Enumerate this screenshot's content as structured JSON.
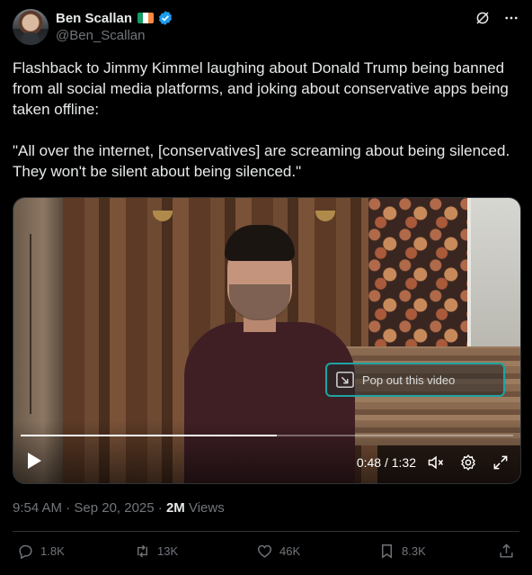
{
  "author": {
    "display_name": "Ben Scallan",
    "handle": "@Ben_Scallan",
    "flag_icon": "ireland-flag-icon",
    "verified_icon": "verified-badge-icon",
    "verified_color": "#1d9bf0"
  },
  "header_actions": [
    "grok-icon",
    "more-icon"
  ],
  "tweet": {
    "text": "Flashback to Jimmy Kimmel laughing about Donald Trump being banned from all social media platforms, and joking about conservative apps being taken offline:\n\n\"All over the internet, [conservatives] are screaming about being silenced. They won't be silent about being silenced.\""
  },
  "video": {
    "popout_label": "Pop out this video",
    "time_display": "0:48 / 1:32",
    "progress": 0.52,
    "accent_color": "#1fa3a3"
  },
  "meta": {
    "timestamp": "9:54 AM · Sep 20, 2025 · ",
    "views_count": "2M",
    "views_label": " Views"
  },
  "actions": {
    "replies": "1.8K",
    "reposts": "13K",
    "likes": "46K",
    "bookmarks": "8.3K"
  }
}
